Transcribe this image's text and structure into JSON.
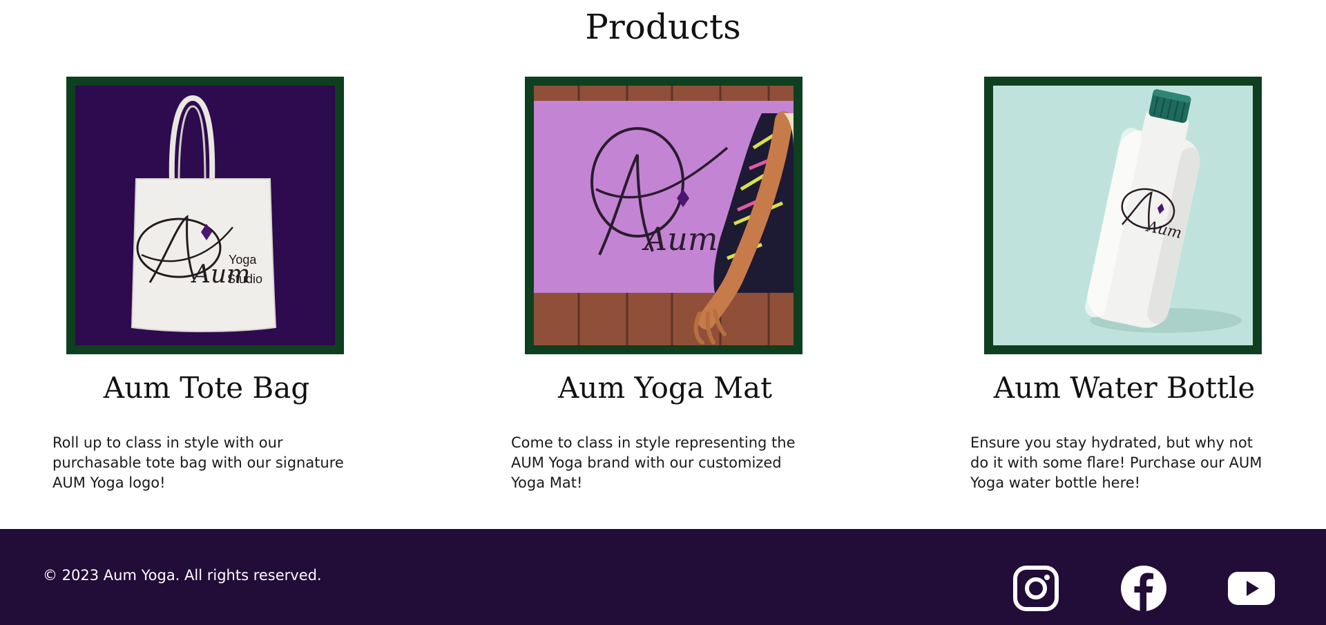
{
  "page": {
    "section_title": "Products"
  },
  "products": [
    {
      "name": "Aum Tote Bag",
      "description": "Roll up to class in style with our purchasable tote bag with our signature AUM Yoga logo!",
      "image_logo_text": "Aum",
      "image_sub_text_1": "Yoga",
      "image_sub_text_2": "Studio"
    },
    {
      "name": "Aum Yoga Mat",
      "description": "Come to class in style representing the AUM Yoga brand with our customized Yoga Mat!",
      "image_logo_text": "Aum"
    },
    {
      "name": "Aum Water Bottle",
      "description": "Ensure you stay hydrated, but why not do it with some flare! Purchase our AUM Yoga water bottle here!",
      "image_logo_text": "Aum"
    }
  ],
  "footer": {
    "copyright": "© 2023 Aum Yoga. All rights reserved.",
    "social_icons": [
      "instagram-icon",
      "facebook-icon",
      "youtube-icon"
    ]
  },
  "colors": {
    "frame_green": "#0e3f1e",
    "footer_purple": "#220c38",
    "tote_bg_purple": "#2e0a4e",
    "mat_lilac": "#c98ad8",
    "bottle_bg_mint": "#bfe3dc",
    "logo_diamond": "#4b1670"
  }
}
